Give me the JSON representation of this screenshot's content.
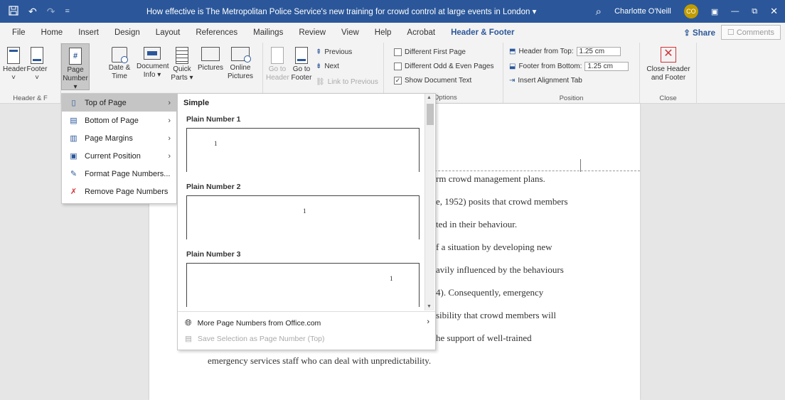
{
  "titlebar": {
    "doc_title": "How effective is The Metropolitan Police Service's new training for crowd control at large events in London",
    "title_dropdown": "▾",
    "user": "Charlotte O'Neill",
    "initials": "CO",
    "save_icon": "save-icon",
    "undo_icon": "↶",
    "redo_icon": "↷",
    "qa_icon": "=",
    "search_icon": "⌕",
    "display_icon": "▣",
    "minimize": "—",
    "restore": "⧉",
    "close": "✕"
  },
  "tabs": [
    "File",
    "Home",
    "Insert",
    "Design",
    "Layout",
    "References",
    "Mailings",
    "Review",
    "View",
    "Help",
    "Acrobat",
    "Header & Footer"
  ],
  "share_label": "Share",
  "comments_label": "Comments",
  "ribbon": {
    "hf_group": {
      "header": "Header",
      "footer": "Footer",
      "page_number": "Page",
      "page_number2": "Number ▾",
      "label": "Header & F"
    },
    "insert_group": {
      "date_time": "Date &",
      "date_time2": "Time",
      "doc_info": "Document",
      "doc_info2": "Info ▾",
      "quick_parts": "Quick",
      "quick_parts2": "Parts ▾",
      "pictures": "Pictures",
      "online_pictures": "Online",
      "online_pictures2": "Pictures"
    },
    "nav_group": {
      "goto_header": "Go to",
      "goto_header2": "Header",
      "goto_footer": "Go to",
      "goto_footer2": "Footer",
      "previous": "Previous",
      "next": "Next",
      "link_prev": "Link to Previous"
    },
    "options_group": {
      "diff_first": "Different First Page",
      "diff_odd_even": "Different Odd & Even Pages",
      "show_doc_text": "Show Document Text",
      "label": "Options"
    },
    "position_group": {
      "header_from_top": "Header from Top:",
      "header_val": "1.25 cm",
      "footer_from_bottom": "Footer from Bottom:",
      "footer_val": "1.25 cm",
      "insert_align": "Insert Alignment Tab",
      "label": "Position"
    },
    "close_group": {
      "close_hf": "Close Header",
      "close_hf2": "and Footer",
      "label": "Close"
    }
  },
  "page_number_menu": [
    {
      "label": "Top of Page",
      "accel": "T",
      "submenu": true,
      "selected": true
    },
    {
      "label": "Bottom of Page",
      "accel": "B",
      "submenu": true
    },
    {
      "label": "Page Margins",
      "accel": "P",
      "submenu": true
    },
    {
      "label": "Current Position",
      "accel": "C",
      "submenu": true
    },
    {
      "label": "Format Page Numbers...",
      "accel": "F",
      "submenu": false
    },
    {
      "label": "Remove Page Numbers",
      "accel": "R",
      "submenu": false
    }
  ],
  "gallery": {
    "heading": "Simple",
    "items": [
      {
        "label": "Plain Number 1",
        "num": "1"
      },
      {
        "label": "Plain Number 2",
        "num": "1"
      },
      {
        "label": "Plain Number 3",
        "num": "1"
      }
    ],
    "more": "More Page Numbers from Office.com",
    "save_selection": "Save Selection as Page Number (Top)"
  },
  "document_lines": [
    "rm crowd management plans.",
    "e, 1952) posits that crowd members",
    "ted in their behaviour.",
    "f a situation by developing new",
    "avily influenced by the behaviours",
    "4).  Consequently, emergency",
    "sibility that crowd members will",
    "he support of well-trained",
    "emergency services staff who can deal with unpredictability."
  ],
  "colors": {
    "accent": "#2b579a",
    "avatar": "#c19c00",
    "close_red": "#d13438"
  }
}
